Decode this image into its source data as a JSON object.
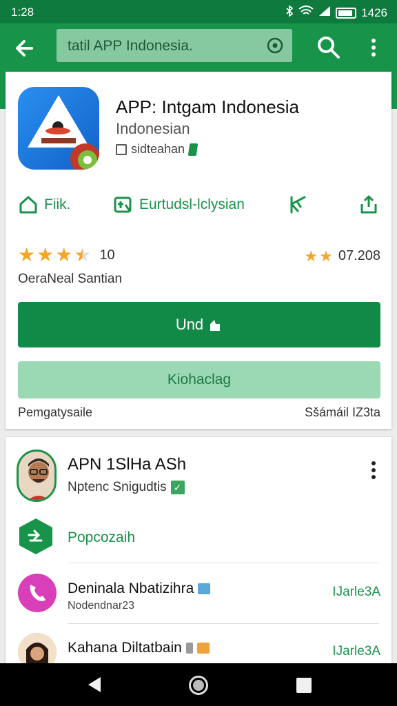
{
  "status_bar": {
    "time": "1:28",
    "battery_text": "1426"
  },
  "app_bar": {
    "search_text": "tatil APP Indonesia."
  },
  "app_card": {
    "title": "APP: Intgam Indonesia",
    "subtitle": "Indonesian",
    "developer": "sidteahan",
    "actions": [
      {
        "label": "Fiik."
      },
      {
        "label": "Eurtudsl-lclysian"
      },
      {
        "label": ""
      },
      {
        "label": ""
      }
    ],
    "rating": {
      "stars": 3.5,
      "count": "10",
      "right_value": "07.208",
      "right_stars": 2,
      "label": "OeraNeal Santian"
    },
    "primary_button": "Und",
    "secondary_button": "Kiohaclag",
    "footer_left": "Pemgatysaile",
    "footer_right": "Sšámáil IZ3ta"
  },
  "developer_card": {
    "name": "APN 1SlHa ASh",
    "status": "Nptenc Snigudtis",
    "section_label": "Popcozaih",
    "rows": [
      {
        "title": "Deninala Nbatizihra",
        "subtitle": "Nodendnar23",
        "action": "IJarle3A",
        "icon_color": "#d93fb8"
      },
      {
        "title": "Kahana Diltatbain",
        "subtitle": "",
        "action": "IJarle3A",
        "icon_color": "#e9a86c"
      }
    ]
  },
  "colors": {
    "primary": "#17934a",
    "status_bar": "#0f7a3d",
    "secondary_button": "#9ad9b4",
    "star": "#f4a52a"
  },
  "icons": {
    "back": "arrow-left-icon",
    "search": "search-icon",
    "menu": "more-vert-icon",
    "target": "target-icon",
    "share": "share-icon"
  }
}
